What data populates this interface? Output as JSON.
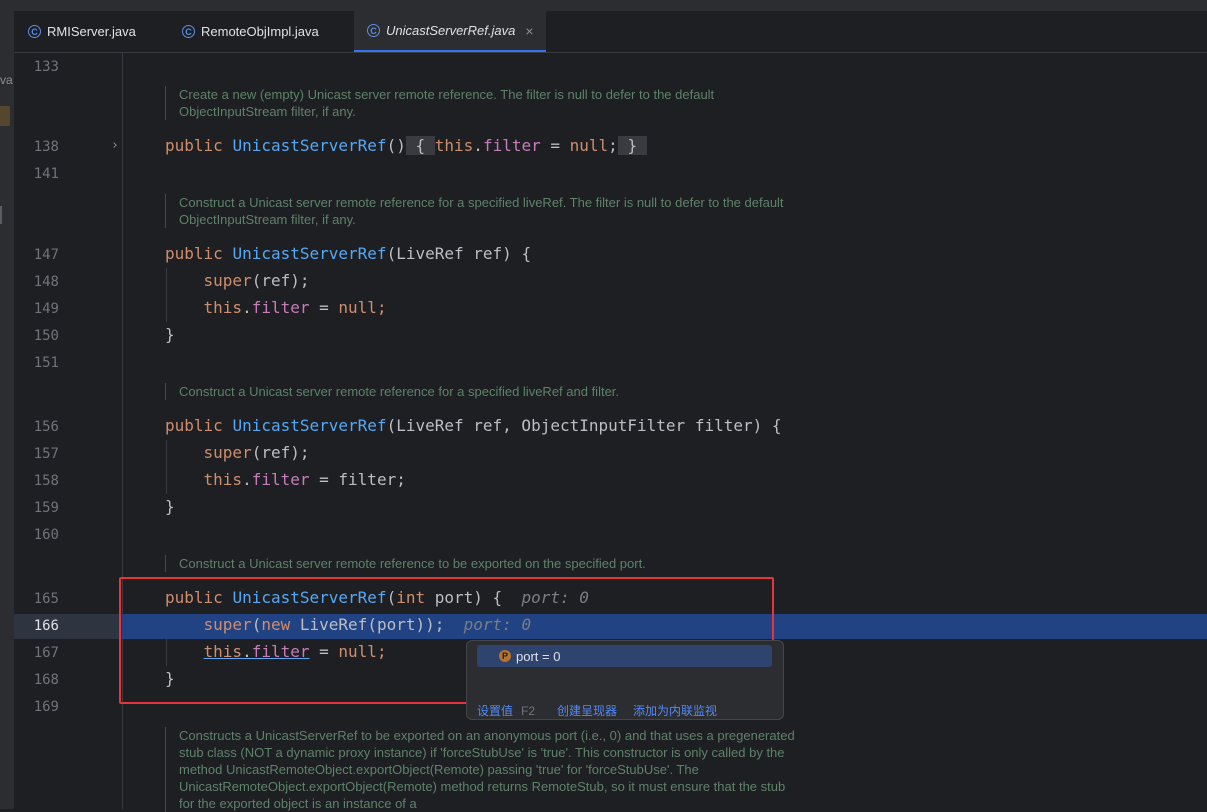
{
  "tabs": [
    {
      "label": "RMIServer.java",
      "icon": "class-icon",
      "active": false
    },
    {
      "label": "RemoteObjImpl.java",
      "icon": "class-icon",
      "active": false
    },
    {
      "label": "UnicastServerRef.java",
      "icon": "class-icon",
      "active": true
    }
  ],
  "left_strip_text": "va",
  "gutter": [
    "133",
    "138",
    "141",
    "147",
    "148",
    "149",
    "150",
    "151",
    "156",
    "157",
    "158",
    "159",
    "160",
    "165",
    "166",
    "167",
    "168",
    "169"
  ],
  "docs": {
    "d1": "Create a new (empty) Unicast server remote reference. The filter is null to defer to the default ObjectInputStream filter, if any.",
    "d2": "Construct a Unicast server remote reference for a specified liveRef. The filter is null to defer to the default ObjectInputStream filter, if any.",
    "d3": "Construct a Unicast server remote reference for a specified liveRef and filter.",
    "d4": "Construct a Unicast server remote reference to be exported on the specified port.",
    "d5": "Constructs a UnicastServerRef to be exported on an anonymous port (i.e., 0) and that uses a pregenerated stub class (NOT a dynamic proxy instance) if 'forceStubUse' is 'true'. This constructor is only called by the method UnicastRemoteObject.exportObject(Remote) passing 'true' for 'forceStubUse'. The UnicastRemoteObject.exportObject(Remote) method returns RemoteStub, so it must ensure that the stub for the exported object is an instance of a"
  },
  "tokens": {
    "public": "public",
    "class_name": "UnicastServerRef",
    "paren_open": "(",
    "paren_close": ")",
    "paren_close_brace": ") {",
    "brace_open": "{",
    "brace_close": "}",
    "this": "this",
    "dot": ".",
    "filter": "filter",
    "eq": " = ",
    "null": "null",
    "semi": ";",
    "super": "super",
    "ref_call": "(ref);",
    "liveref_param": "LiveRef ref",
    "liveref_filter_params": "LiveRef ref, ObjectInputFilter filter",
    "filter_value": "filter;",
    "int": "int",
    "port_param": " port",
    "new": "new",
    "liveref_call": " LiveRef(port));",
    "null_semi": "null;"
  },
  "inlay_hint": "port: 0",
  "popup": {
    "item": "port = 0",
    "item_icon": "P",
    "set_value": "设置值",
    "set_value_key": "F2",
    "create_renderer": "创建呈现器",
    "add_inline_watch": "添加为内联监视"
  }
}
